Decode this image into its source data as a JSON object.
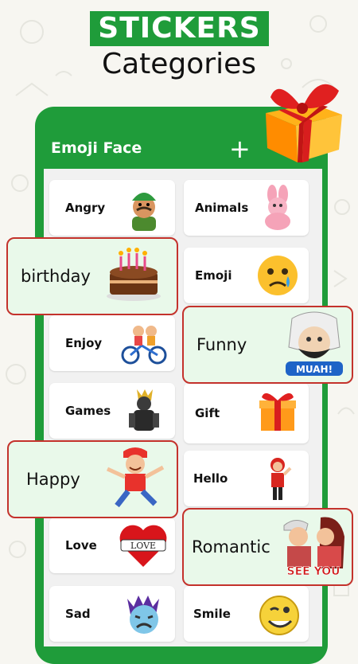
{
  "header": {
    "banner": "STICKERS",
    "subtitle": "Categories"
  },
  "appbar": {
    "title": "Emoji Face",
    "add_label": "+"
  },
  "categories": {
    "angry": "Angry",
    "animals": "Animals",
    "birthday": "birthday",
    "emoji": "Emoji",
    "enjoy": "Enjoy",
    "funny": "Funny",
    "games": "Games",
    "gift": "Gift",
    "happy": "Happy",
    "hello": "Hello",
    "love": "Love",
    "romantic": "Romantic",
    "sad": "Sad",
    "smile": "Smile"
  },
  "sticker_text": {
    "love": "LOVE",
    "funny": "MUAH!",
    "romantic": "SEE YOU"
  },
  "colors": {
    "brand_green": "#1f9c3a",
    "highlight_border": "#c4322c",
    "highlight_bg": "#e9f9ea"
  }
}
